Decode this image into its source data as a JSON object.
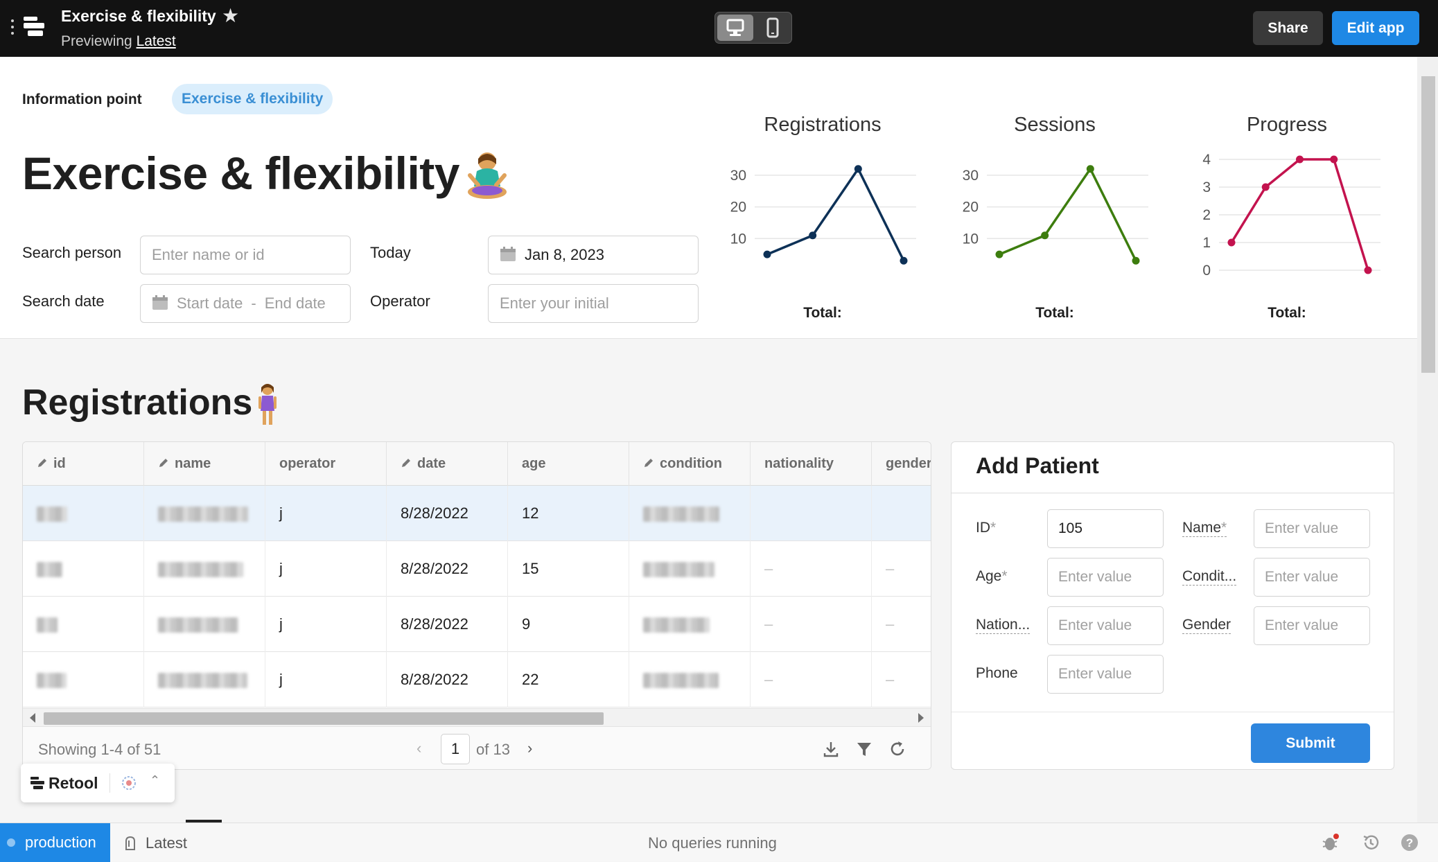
{
  "topbar": {
    "title": "Exercise & flexibility",
    "previewing_label": "Previewing",
    "version_link": "Latest",
    "share_label": "Share",
    "edit_label": "Edit app"
  },
  "header": {
    "info_label": "Information point",
    "tag": "Exercise & flexibility",
    "page_title": "Exercise & flexibility",
    "search_person_label": "Search person",
    "search_person_placeholder": "Enter name or id",
    "today_label": "Today",
    "today_value": "Jan 8, 2023",
    "search_date_label": "Search date",
    "start_date_placeholder": "Start date",
    "end_date_placeholder": "End date",
    "operator_label": "Operator",
    "operator_placeholder": "Enter your initial"
  },
  "chart_data": [
    {
      "type": "line",
      "title": "Registrations",
      "x": [
        1,
        2,
        3,
        4
      ],
      "values": [
        5,
        11,
        32,
        3
      ],
      "yticks": [
        10,
        20,
        30
      ],
      "ylim": [
        0,
        35
      ],
      "color": "#0d3157",
      "footer": "Total:"
    },
    {
      "type": "line",
      "title": "Sessions",
      "x": [
        1,
        2,
        3,
        4
      ],
      "values": [
        5,
        11,
        32,
        3
      ],
      "yticks": [
        10,
        20,
        30
      ],
      "ylim": [
        0,
        35
      ],
      "color": "#3d7d0e",
      "footer": "Total:"
    },
    {
      "type": "line",
      "title": "Progress",
      "x": [
        1,
        2,
        3,
        4,
        5
      ],
      "values": [
        1,
        3,
        4,
        4,
        0
      ],
      "yticks": [
        0,
        1,
        2,
        3,
        4
      ],
      "ylim": [
        0,
        4
      ],
      "color": "#c3134e",
      "footer": "Total:"
    }
  ],
  "registrations": {
    "title": "Registrations",
    "columns": [
      "id",
      "name",
      "operator",
      "date",
      "age",
      "condition",
      "nationality",
      "gender"
    ],
    "editable": [
      true,
      true,
      false,
      true,
      false,
      true,
      false,
      false
    ],
    "rows": [
      {
        "operator": "j",
        "date": "8/28/2022",
        "age": "12",
        "nationality": "",
        "gender": ""
      },
      {
        "operator": "j",
        "date": "8/28/2022",
        "age": "15",
        "nationality": "–",
        "gender": "–"
      },
      {
        "operator": "j",
        "date": "8/28/2022",
        "age": "9",
        "nationality": "–",
        "gender": "–"
      },
      {
        "operator": "j",
        "date": "8/28/2022",
        "age": "22",
        "nationality": "–",
        "gender": "–"
      }
    ],
    "showing": "Showing 1-4 of 51",
    "page": "1",
    "page_of": "of 13"
  },
  "form": {
    "title": "Add Patient",
    "id_label": "ID",
    "id_value": "105",
    "name_label": "Name",
    "age_label": "Age",
    "condition_label": "Condit...",
    "nationality_label": "Nation...",
    "gender_label": "Gender",
    "phone_label": "Phone",
    "placeholder": "Enter value",
    "required_mark": "*",
    "submit_label": "Submit"
  },
  "retool": {
    "name": "Retool"
  },
  "statusbar": {
    "env": "production",
    "version": "Latest",
    "queries": "No queries running"
  },
  "colors": {
    "accent": "#1e88e5",
    "tag_bg": "#dbeefc",
    "tag_text": "#3a8fd4"
  }
}
